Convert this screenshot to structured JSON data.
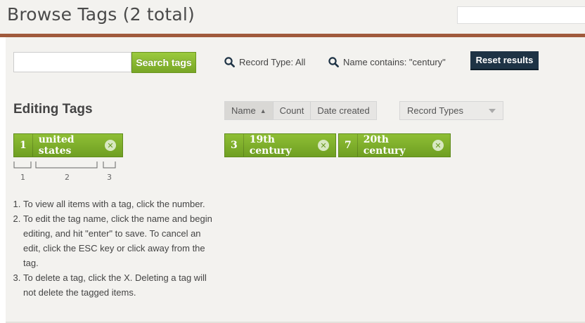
{
  "header": {
    "title": "Browse Tags (2 total)",
    "search_placeholder": ""
  },
  "search": {
    "input_placeholder": "",
    "button_label": "Search tags"
  },
  "filters": {
    "record_type": "Record Type: All",
    "name_contains": "Name contains: \"century\"",
    "reset_label": "Reset results"
  },
  "editing": {
    "title": "Editing Tags",
    "example_tag": {
      "count": "1",
      "name": "united states"
    },
    "guide_labels": [
      "1",
      "2",
      "3"
    ],
    "instructions": [
      "To view all items with a tag, click the number.",
      "To edit the tag name, click the name and begin editing, and hit \"enter\" to save. To cancel an edit, click the ESC key or click away from the tag.",
      "To delete a tag, click the X. Deleting a tag will not delete the tagged items."
    ]
  },
  "sort": {
    "name": "Name",
    "count": "Count",
    "date_created": "Date created",
    "record_types": "Record Types"
  },
  "tags": [
    {
      "count": "3",
      "name": "19th century"
    },
    {
      "count": "7",
      "name": "20th century"
    }
  ],
  "icons": {
    "search": "search-icon",
    "delete": "close-circle-icon",
    "sort": "sort-up-icon",
    "dropdown": "chevron-down-icon"
  },
  "colors": {
    "brand_rule": "#a05a3c",
    "tag_green": "#7aaa2a",
    "reset_navy": "#1e3345",
    "panel_bg": "#f3f2ef"
  }
}
